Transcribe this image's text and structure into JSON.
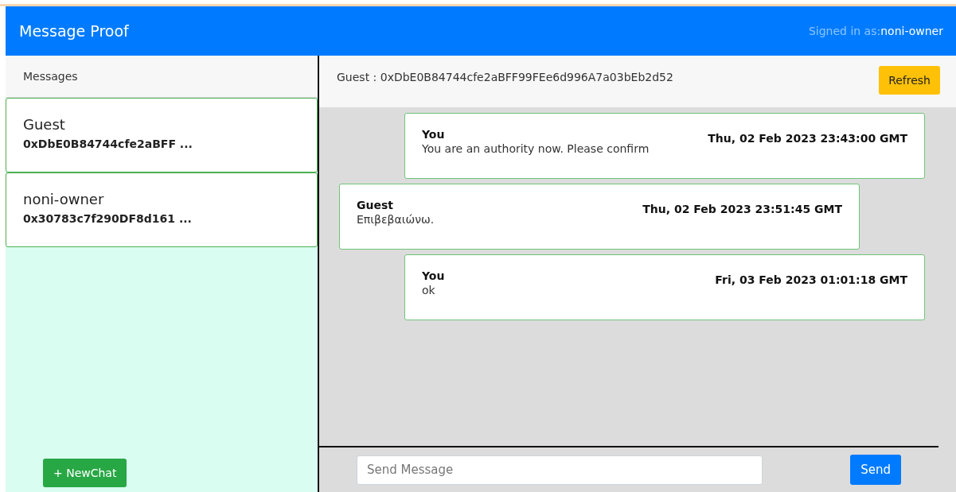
{
  "navbar": {
    "brand": "Message Proof",
    "signed_in_label": "Signed in as:",
    "signed_in_user": "noni-owner"
  },
  "sidebar": {
    "title": "Messages",
    "chats": [
      {
        "name": "Guest",
        "address": "0xDbE0B84744cfe2aBFF ..."
      },
      {
        "name": "noni-owner",
        "address": "0x30783c7f290DF8d161 ..."
      }
    ],
    "new_chat_button": "+ NewChat"
  },
  "conversation": {
    "header": "Guest : 0xDbE0B84744cfe2aBFF99FEe6d996A7a03bEb2d52",
    "refresh_button": "Refresh",
    "messages": [
      {
        "kind": "outgoing",
        "sender": "You",
        "text": "You are an authority now. Please confirm",
        "time": "Thu, 02 Feb 2023 23:43:00 GMT"
      },
      {
        "kind": "incoming",
        "sender": "Guest",
        "text": "Επιβεβαιώνω.",
        "time": "Thu, 02 Feb 2023 23:51:45 GMT"
      },
      {
        "kind": "outgoing",
        "sender": "You",
        "text": "ok",
        "time": "Fri, 03 Feb 2023 01:01:18 GMT"
      }
    ],
    "composer": {
      "placeholder": "Send Message",
      "send_button": "Send"
    }
  }
}
